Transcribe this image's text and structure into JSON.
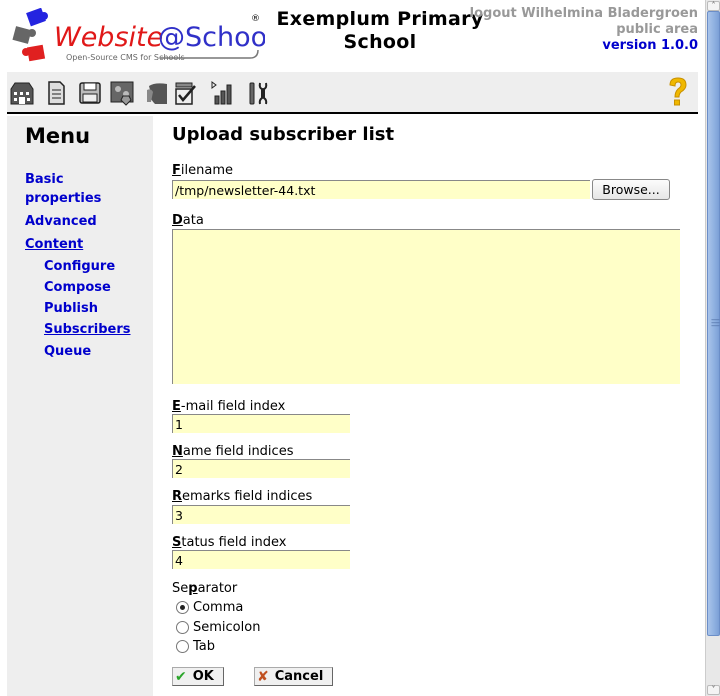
{
  "header": {
    "logo_text": "Website@School",
    "logo_tagline": "Open-Source CMS for Schools",
    "site_title_line1": "Exemplum Primary",
    "site_title_line2": "School",
    "logout_text": "logout Wilhelmina Bladergroen",
    "area_text": "public area",
    "version_text": "version 1.0.0"
  },
  "toolbar": {
    "icons": [
      "start-center-icon",
      "page-manager-icon",
      "file-manager-icon",
      "modules-icon",
      "account-manager-icon",
      "configuration-manager-icon",
      "statistics-icon",
      "tools-icon"
    ],
    "help_icon": "help-icon"
  },
  "sidebar": {
    "title": "Menu",
    "items": [
      {
        "label": "Basic",
        "label2": "properties"
      },
      {
        "label": "Advanced"
      },
      {
        "label": "Content"
      },
      {
        "label": "Configure"
      },
      {
        "label": "Compose"
      },
      {
        "label": "Publish"
      },
      {
        "label": "Subscribers"
      },
      {
        "label": "Queue"
      }
    ]
  },
  "main": {
    "title": "Upload subscriber list",
    "filename": {
      "accesskey": "F",
      "label_rest": "ilename",
      "value": "/tmp/newsletter-44.txt",
      "browse_label": "Browse..."
    },
    "data": {
      "accesskey": "D",
      "label_rest": "ata",
      "value": ""
    },
    "email_index": {
      "accesskey": "E",
      "label_rest": "-mail field index",
      "value": "1"
    },
    "name_indices": {
      "accesskey": "N",
      "label_rest": "ame field indices",
      "value": "2"
    },
    "remarks_indices": {
      "accesskey": "R",
      "label_rest": "emarks field indices",
      "value": "3"
    },
    "status_index": {
      "accesskey": "S",
      "label_rest": "tatus field index",
      "value": "4"
    },
    "separator": {
      "label_pre": "Se",
      "accesskey": "p",
      "label_rest": "arator",
      "options": [
        "Comma",
        "Semicolon",
        "Tab"
      ],
      "selected": "Comma"
    },
    "ok_label": "OK",
    "cancel_label": "Cancel"
  },
  "colors": {
    "link": "#0000cc",
    "input_bg": "#ffffc8",
    "sidebar_bg": "#eeeeee"
  }
}
